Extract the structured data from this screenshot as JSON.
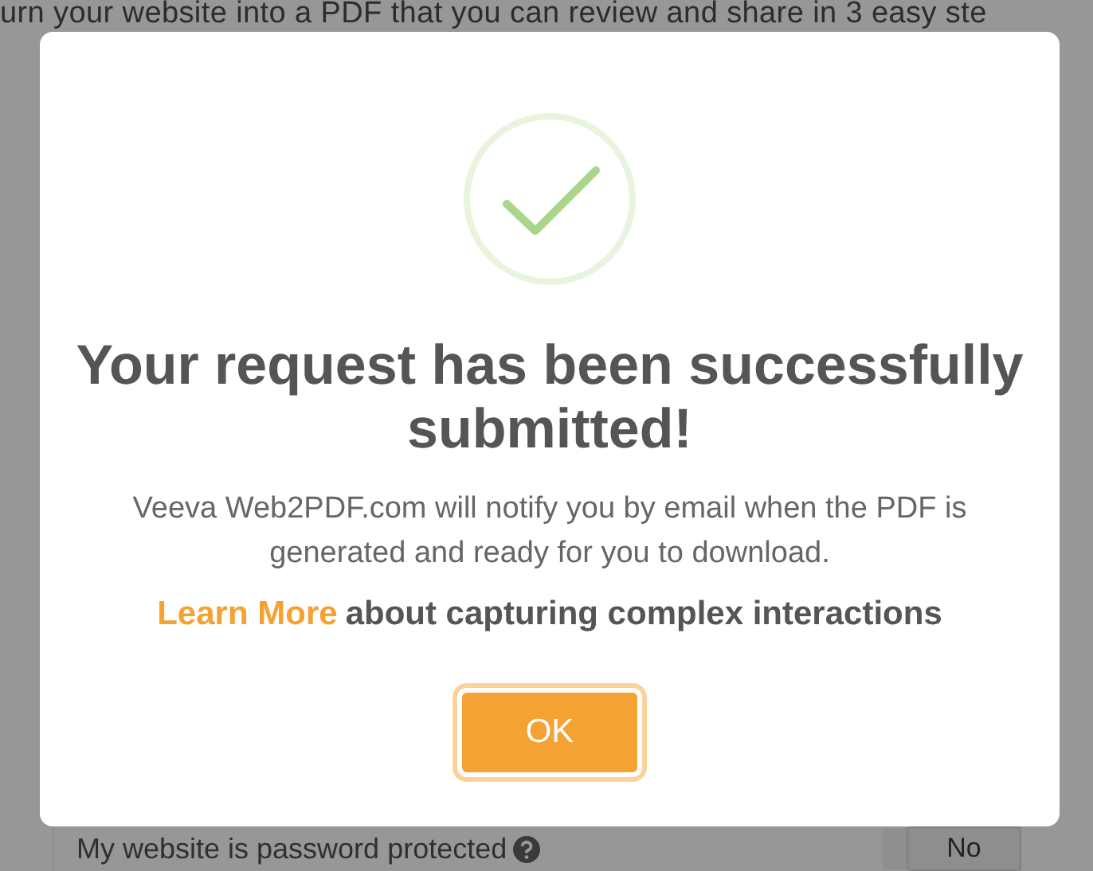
{
  "page": {
    "headline": "urn your website into a PDF that you can review and share in 3 easy ste",
    "password_row": {
      "label": "My website is password protected",
      "toggle": "No"
    }
  },
  "dialog": {
    "title": "Your request has been successfully submitted!",
    "message": "Veeva Web2PDF.com will notify you by email when the PDF is generated and ready for you to download.",
    "link": "Learn More",
    "link_suffix": "about capturing complex interactions",
    "button": "OK"
  }
}
